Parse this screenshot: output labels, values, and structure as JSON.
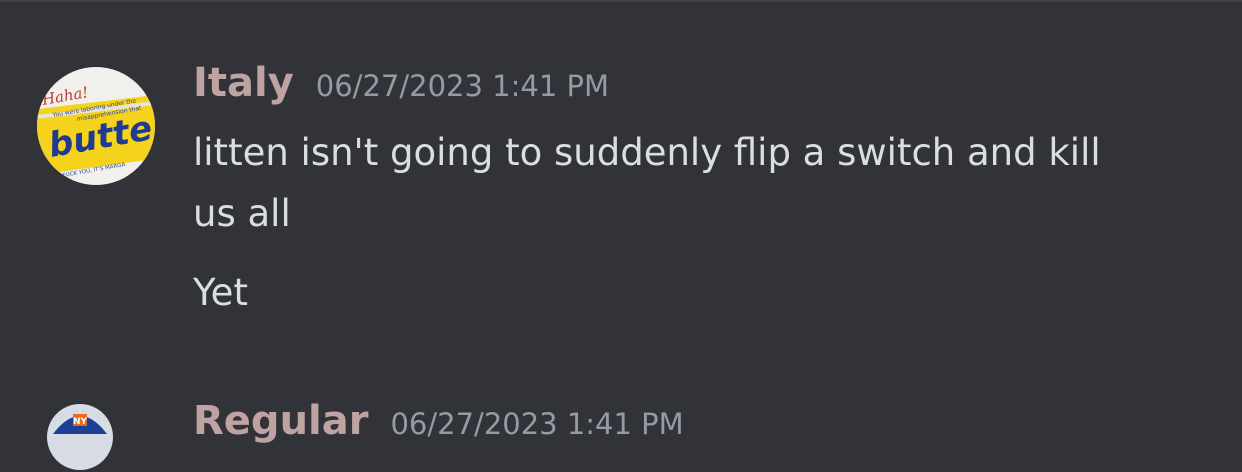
{
  "messages": [
    {
      "username": "Italy",
      "timestamp": "06/27/2023 1:41 PM",
      "avatar": {
        "icon": "butter-label-avatar",
        "text_top": "Haha!",
        "text_small": "You were laboring under the misapprehension that",
        "text_main": "butte",
        "text_bottom": "FUCK YOU, IT'S MARGA"
      },
      "lines": [
        "litten isn't going to suddenly flip a switch and kill",
        "us all",
        "Yet"
      ]
    },
    {
      "username": "Regular",
      "timestamp": "06/27/2023 1:41 PM",
      "avatar": {
        "icon": "mets-cap-avatar",
        "text_logo": "NY"
      }
    }
  ]
}
